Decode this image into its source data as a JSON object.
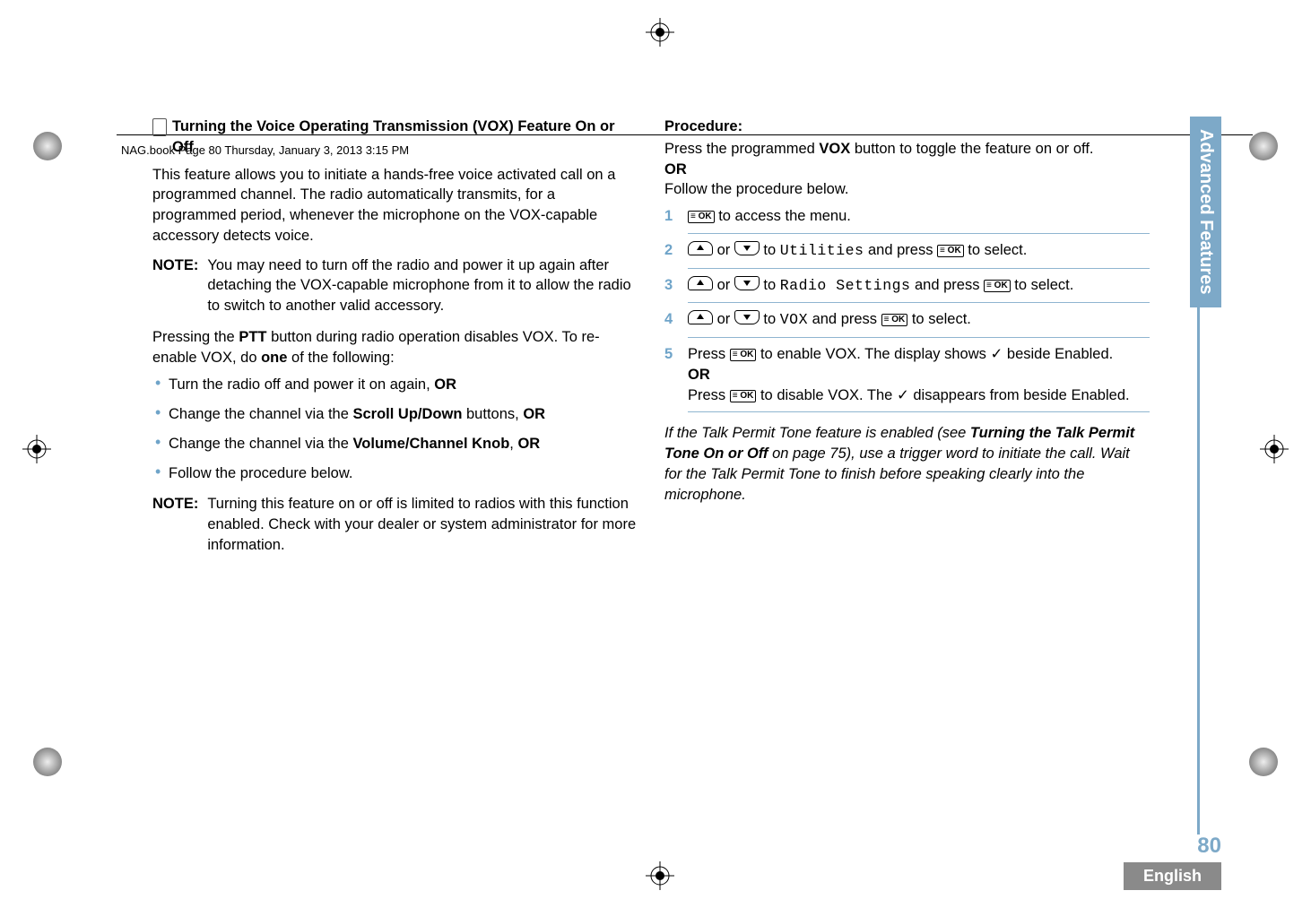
{
  "header": {
    "running": "NAG.book  Page 80  Thursday, January 3, 2013  3:15 PM"
  },
  "left": {
    "title": "Turning the Voice Operating Transmission (VOX) Feature On or Off",
    "intro": "This feature allows you to initiate a hands-free voice activated call on a programmed channel. The radio automatically transmits, for a programmed period, whenever the microphone on the VOX-capable accessory detects voice.",
    "note1_label": "NOTE:",
    "note1": "You may need to turn off the radio and power it up again after detaching the VOX-capable microphone from it to allow the radio to switch to another valid accessory.",
    "para2a": "Pressing the ",
    "para2b": "PTT",
    "para2c": " button during radio operation disables VOX. To re-enable VOX, do ",
    "para2d": "one",
    "para2e": " of the following:",
    "bullets": {
      "b1a": "Turn the radio off and power it on again, ",
      "b1b": "OR",
      "b2a": "Change the channel via the ",
      "b2b": "Scroll Up/Down",
      "b2c": " buttons, ",
      "b2d": "OR",
      "b3a": "Change the channel via the ",
      "b3b": "Volume/Channel Knob",
      "b3c": ", ",
      "b3d": "OR",
      "b4": "Follow the procedure below."
    },
    "note2_label": "NOTE:",
    "note2": "Turning this feature on or off is limited to radios with this function enabled. Check with your dealer or system administrator for more information."
  },
  "right": {
    "proc_label": "Procedure:",
    "intro1a": "Press the programmed ",
    "intro1b": "VOX",
    "intro1c": " button to toggle the feature on or off.",
    "or": "OR",
    "intro2": "Follow the procedure below.",
    "ok_label": "≡ OK",
    "steps": {
      "s1": {
        "num": "1",
        "tail": " to access the menu."
      },
      "s2": {
        "num": "2",
        "mid": " to ",
        "menu": "Utilities",
        "tail1": " and press ",
        "tail2": " to select."
      },
      "s3": {
        "num": "3",
        "mid": " to ",
        "menu": "Radio Settings",
        "tail1": " and press ",
        "tail2": " to select."
      },
      "s4": {
        "num": "4",
        "mid": " to ",
        "menu": "VOX",
        "tail1": " and press ",
        "tail2": " to select."
      },
      "s5": {
        "num": "5",
        "a1": "Press ",
        "a2": " to enable VOX. The display shows ",
        "check": "✓",
        "a3": " beside Enabled.",
        "or": "OR",
        "b1": "Press ",
        "b2": " to disable VOX. The ",
        "b3": " disappears from beside Enabled."
      }
    },
    "footnote_a": "If the Talk Permit Tone feature is enabled (see ",
    "footnote_b": "Turning the Talk Permit Tone On or Off",
    "footnote_c": " on page 75), use a trigger word to initiate the call. Wait for the Talk Permit Tone to finish before speaking clearly into the microphone."
  },
  "sidebar": {
    "tab": "Advanced Features",
    "page": "80",
    "lang": "English"
  },
  "glue": {
    "or_word": " or "
  }
}
